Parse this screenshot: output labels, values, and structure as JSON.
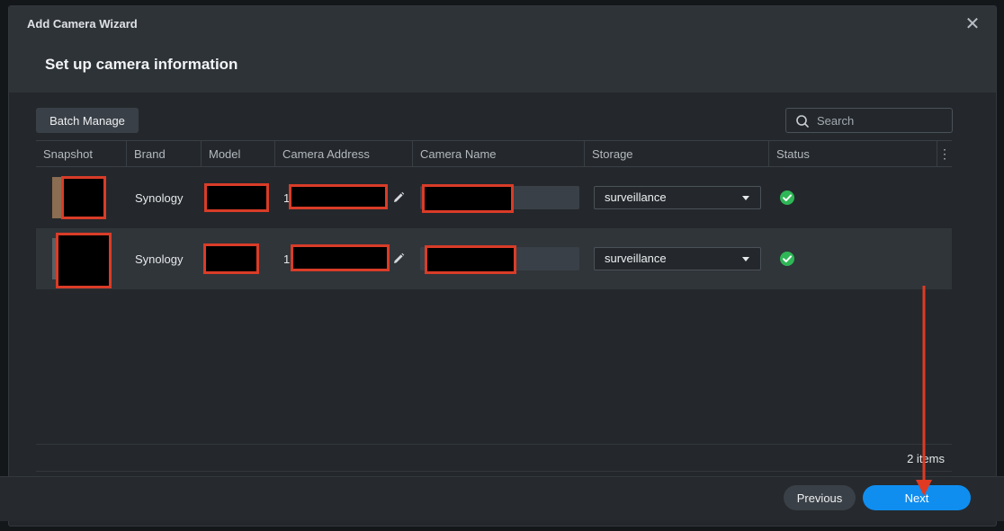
{
  "dialog": {
    "title": "Add Camera Wizard",
    "step_title": "Set up camera information",
    "close_glyph": "✕"
  },
  "toolbar": {
    "batch_label": "Batch Manage",
    "search_placeholder": "Search"
  },
  "table": {
    "columns": [
      "Snapshot",
      "Brand",
      "Model",
      "Camera Address",
      "Camera Name",
      "Storage",
      "Status"
    ],
    "more_glyph": "⋮",
    "rows": [
      {
        "brand": "Synology",
        "address_prefix": "1",
        "storage": "surveillance",
        "status_icon": "check-circle-icon"
      },
      {
        "brand": "Synology",
        "address_prefix": "1",
        "storage": "surveillance",
        "status_icon": "check-circle-icon"
      }
    ]
  },
  "footer": {
    "item_count": "2 items",
    "previous_label": "Previous",
    "next_label": "Next"
  },
  "colors": {
    "accent": "#0f8ef0",
    "status_ok": "#2fb657",
    "redaction_border": "#d93c28",
    "annotation_arrow": "#e03a22"
  }
}
